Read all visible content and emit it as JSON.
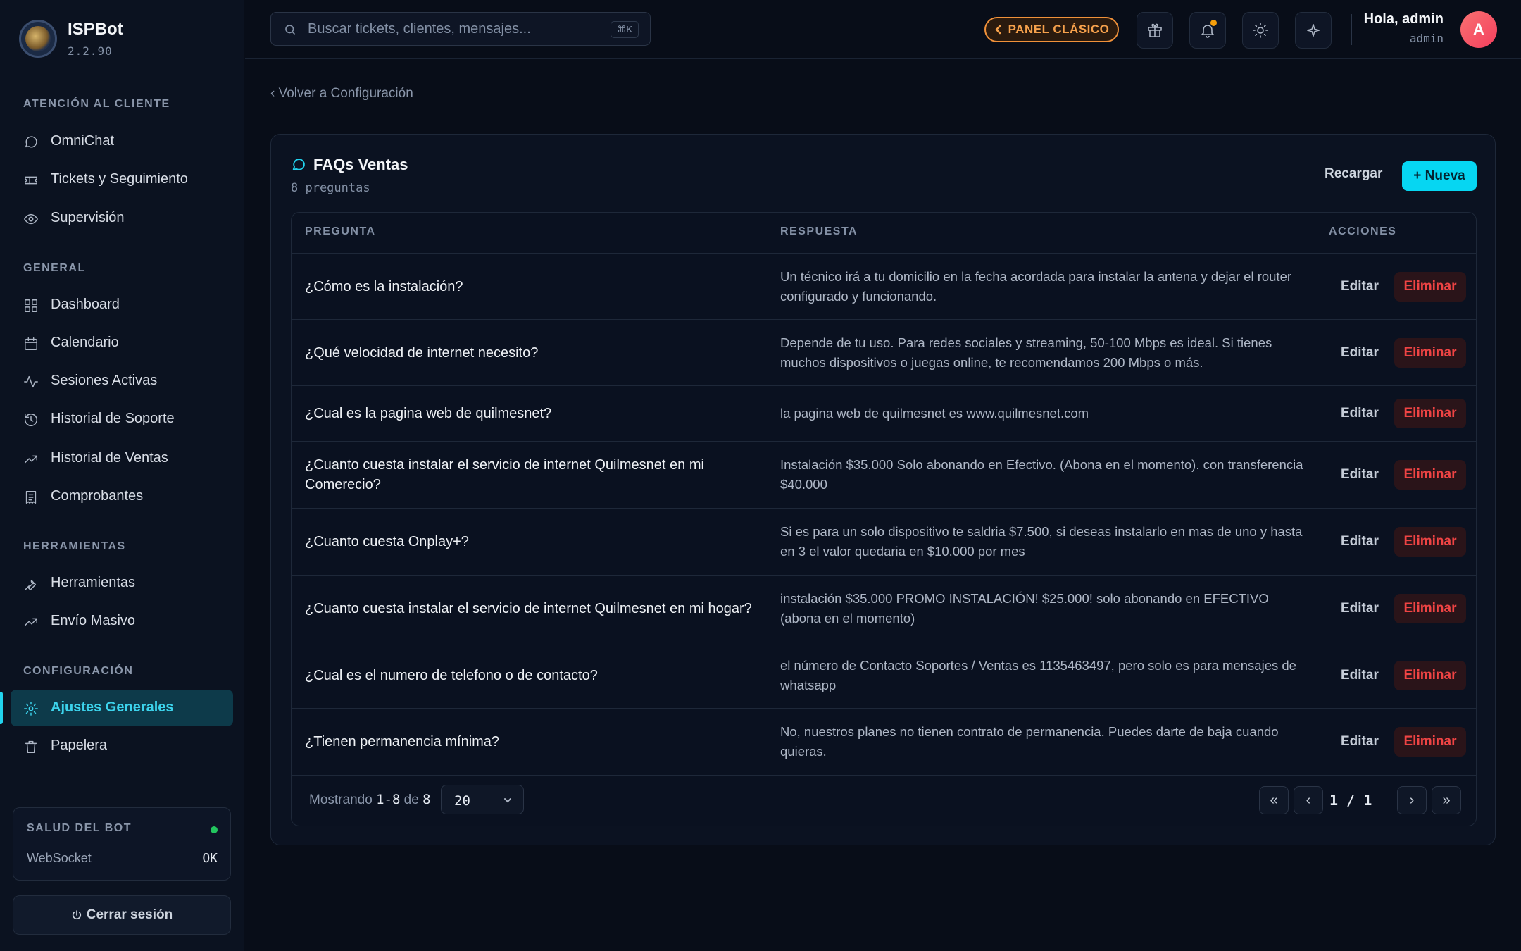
{
  "brand": {
    "name": "ISPBot",
    "version": "2.2.90"
  },
  "sidebar": {
    "sections": [
      {
        "title": "ATENCIÓN AL CLIENTE",
        "items": [
          {
            "label": "OmniChat",
            "icon": "chat-bubble-icon"
          },
          {
            "label": "Tickets y Seguimiento",
            "icon": "ticket-icon"
          },
          {
            "label": "Supervisión",
            "icon": "eye-icon"
          }
        ]
      },
      {
        "title": "GENERAL",
        "items": [
          {
            "label": "Dashboard",
            "icon": "grid-icon"
          },
          {
            "label": "Calendario",
            "icon": "calendar-icon"
          },
          {
            "label": "Sesiones Activas",
            "icon": "activity-icon"
          },
          {
            "label": "Historial de Soporte",
            "icon": "history-icon"
          },
          {
            "label": "Historial de Ventas",
            "icon": "trending-up-icon"
          },
          {
            "label": "Comprobantes",
            "icon": "receipt-icon"
          }
        ]
      },
      {
        "title": "HERRAMIENTAS",
        "items": [
          {
            "label": "Herramientas",
            "icon": "wrench-icon"
          },
          {
            "label": "Envío Masivo",
            "icon": "trending-up-icon"
          }
        ]
      },
      {
        "title": "CONFIGURACIÓN",
        "items": [
          {
            "label": "Ajustes Generales",
            "icon": "gear-icon",
            "active": true
          },
          {
            "label": "Papelera",
            "icon": "trash-icon"
          }
        ]
      }
    ],
    "health": {
      "title": "SALUD DEL BOT",
      "key": "WebSocket",
      "value": "OK",
      "status_color": "#22c55e"
    },
    "logout_label": "Cerrar sesión"
  },
  "header": {
    "search_placeholder": "Buscar tickets, clientes, mensajes...",
    "search_shortcut": "⌘K",
    "classic_label": "PANEL CLÁSICO",
    "greeting": "Hola, admin",
    "username": "admin",
    "avatar_initial": "A"
  },
  "main": {
    "back_label": "‹ Volver a Configuración",
    "title": "FAQs Ventas",
    "subtitle": "8 preguntas",
    "reload_label": "Recargar",
    "new_label": "+ Nueva",
    "columns": {
      "question": "PREGUNTA",
      "answer": "RESPUESTA",
      "actions": "ACCIONES"
    },
    "edit_label": "Editar",
    "delete_label": "Eliminar",
    "rows": [
      {
        "q": "¿Cómo es la instalación?",
        "a": "Un técnico irá a tu domicilio en la fecha acordada para instalar la antena y dejar el router configurado y funcionando."
      },
      {
        "q": "¿Qué velocidad de internet necesito?",
        "a": "Depende de tu uso. Para redes sociales y streaming, 50-100 Mbps es ideal. Si tienes muchos dispositivos o juegas online, te recomendamos 200 Mbps o más."
      },
      {
        "q": "¿Cual es la pagina web de quilmesnet?",
        "a": "la pagina web de quilmesnet es www.quilmesnet.com"
      },
      {
        "q": "¿Cuanto cuesta instalar el servicio de internet Quilmesnet en mi Comerecio?",
        "a": "Instalación $35.000 Solo abonando en Efectivo. (Abona en el momento). con transferencia $40.000"
      },
      {
        "q": "¿Cuanto cuesta Onplay+?",
        "a": "Si es para un solo dispositivo te saldria $7.500, si deseas instalarlo en mas de uno y hasta en 3 el valor quedaria en $10.000 por mes"
      },
      {
        "q": "¿Cuanto cuesta instalar el servicio de internet Quilmesnet en mi hogar?",
        "a": "instalación $35.000 PROMO INSTALACIÓN! $25.000! solo abonando en EFECTIVO (abona en el momento)"
      },
      {
        "q": "¿Cual es el numero de telefono o de contacto?",
        "a": "el número de Contacto Soportes / Ventas es 1135463497, pero solo es para mensajes de whatsapp"
      },
      {
        "q": "¿Tienen permanencia mínima?",
        "a": "No, nuestros planes no tienen contrato de permanencia. Puedes darte de baja cuando quieras."
      }
    ],
    "footer": {
      "showing_prefix": "Mostrando",
      "showing_range": "1-8",
      "showing_of": "de",
      "showing_total": "8",
      "page_size": "20",
      "page_current": "1",
      "page_sep": "/",
      "page_total": "1",
      "first": "«",
      "prev": "‹",
      "next": "›",
      "last": "»"
    }
  },
  "colors": {
    "accent": "#06d6f2",
    "danger": "#ef4444",
    "warning": "#f0913a",
    "background": "#080d18"
  }
}
